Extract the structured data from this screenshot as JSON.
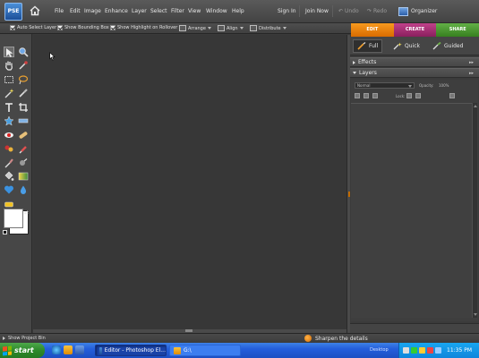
{
  "app": {
    "logo_text": "PSE"
  },
  "menu": [
    "File",
    "Edit",
    "Image",
    "Enhance",
    "Layer",
    "Select",
    "Filter",
    "View",
    "Window",
    "Help"
  ],
  "top_links": {
    "sign_in": "Sign In",
    "join_now": "Join Now",
    "undo": "Undo",
    "redo": "Redo",
    "organizer": "Organizer"
  },
  "options": {
    "auto_select": "Auto Select Layer",
    "show_bounding": "Show Bounding Box",
    "show_highlight": "Show Highlight on Rollover",
    "arrange": "Arrange",
    "align": "Align",
    "distribute": "Distribute"
  },
  "modes": {
    "edit": "EDIT",
    "create": "CREATE",
    "share": "SHARE"
  },
  "view_tabs": {
    "full": "Full",
    "quick": "Quick",
    "guided": "Guided"
  },
  "panels": {
    "effects": "Effects",
    "layers": "Layers",
    "blend_mode": "Normal",
    "opacity_label": "Opacity:",
    "opacity_value": "100%",
    "lock_label": "Lock:"
  },
  "status": {
    "project_bin": "Show Project Bin",
    "tip": "Sharpen the details"
  },
  "taskbar": {
    "start": "start",
    "tasks": [
      "Editor - Photoshop El...",
      "G:\\"
    ],
    "desktop": "Desktop",
    "clock": "11:35 PM"
  },
  "colors": {
    "edit_tab": "#f08a10",
    "create_tab": "#a93075",
    "share_tab": "#4c9a33",
    "canvas": "#373737"
  }
}
